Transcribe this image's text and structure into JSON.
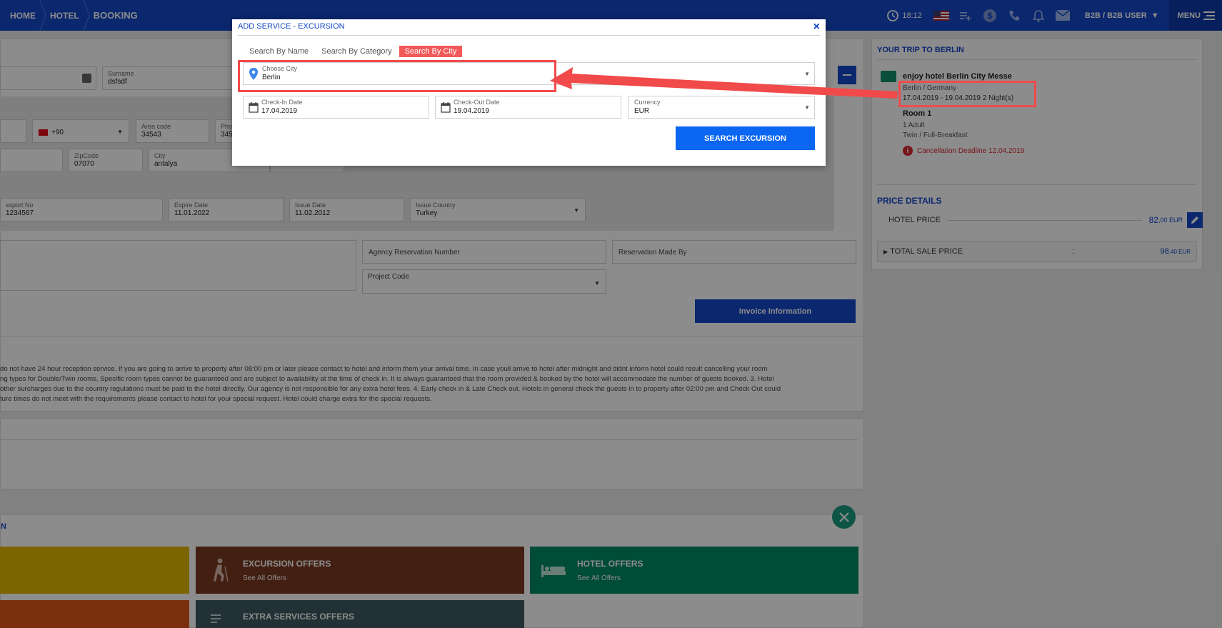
{
  "nav": {
    "crumbs": [
      "HOME",
      "HOTEL",
      "BOOKING"
    ],
    "time": "18:12",
    "user": "B2B / B2B USER",
    "menu": "MENU"
  },
  "form": {
    "surname_label": "Surname",
    "surname_value": "dsfsdf",
    "phone_code": "+90",
    "area_label": "Area code",
    "area_value": "34543",
    "phone_label_partial": "Pho",
    "phone_value_partial": "345",
    "zip_label": "ZipCode",
    "zip_value": "07070",
    "city_label": "City",
    "city_value": "antalya",
    "passport_label": "ssport No",
    "passport_value": "1234567",
    "expire_label": "Expire Date",
    "expire_value": "11.01.2022",
    "issue_label": "Issue Date",
    "issue_value": "11.02.2012",
    "issue_country_label": "Issue Country",
    "issue_country_value": "Turkey",
    "agency_res_placeholder": "Agency Reservation Number",
    "res_made_by_placeholder": "Reservation Made By",
    "project_code_label": "Project Code",
    "invoice_button": "Invoice Information"
  },
  "notice": {
    "line1": "do not have 24 hour reception service. If you are going to arrive to property after 08:00 pm or later please contact to hotel and inform them your arrival time. In case youll arrive to hotel after midnight and didnt inform hotel could result cancelling your room",
    "line2": "ng types for Double/Twin rooms, Specific room types cannot be guaranteed and are subject to availability at the time of check in. It is always guaranteed that the room provided & booked by the hotel will accommodate the number of guests booked. 3. Hotel",
    "line3": "other surcharges due to the country regulations must be paid to the hotel directly. Our agency is not responsible for any extra hotel fees. 4. Early check in & Late Check out. Hotels in general check the guests in to property after 02:00 pm and Check Out could",
    "line4": "ture times do not meet with the requirements please contact to hotel for your special request. Hotel could charge extra for the special requests."
  },
  "offers": {
    "section_label": "N",
    "excursion_title": "EXCURSION OFFERS",
    "excursion_sub": "See All Offers",
    "hotel_title": "HOTEL OFFERS",
    "hotel_sub": "See All Offers",
    "extra_title": "EXTRA SERVICES OFFERS",
    "colors": {
      "yellow": "#e2b700",
      "brown": "#7b3a22",
      "teal": "#008a63",
      "orange": "#e0561a",
      "slate": "#3d5a62"
    }
  },
  "sidebar": {
    "trip_title": "YOUR TRIP TO BERLIN",
    "hotel_name": "enjoy hotel Berlin City Messe",
    "location": "Berlin / Germany",
    "dates": "17.04.2019 - 19.04.2019 2 Night(s)",
    "room": "Room 1",
    "adults": "1 Adult",
    "board": "Twin / Full-Breakfast",
    "cancellation": "Cancellation Deadline 12.04.2019",
    "price_title": "PRICE DETAILS",
    "hotel_price_label": "HOTEL PRICE",
    "hotel_price_int": "82",
    "hotel_price_dec": ",00 EUR",
    "total_label": "TOTAL SALE PRICE",
    "total_colon": ":",
    "total_int": "98",
    "total_dec": ",40 EUR"
  },
  "modal": {
    "title": "ADD SERVICE - EXCURSION",
    "close": "×",
    "tabs": [
      "Search By Name",
      "Search By Category",
      "Search By City"
    ],
    "city_label": "Choose City",
    "city_value": "Berlin",
    "checkin_label": "Check-In Date",
    "checkin_value": "17.04.2019",
    "checkout_label": "Check-Out Date",
    "checkout_value": "19.04.2019",
    "currency_label": "Currency",
    "currency_value": "EUR",
    "search_button": "SEARCH EXCURSION"
  },
  "colors": {
    "primary": "#1448c8",
    "accent_tab": "#f25a5a",
    "search_btn": "#0b66f2",
    "annotation": "#f24a4a"
  }
}
